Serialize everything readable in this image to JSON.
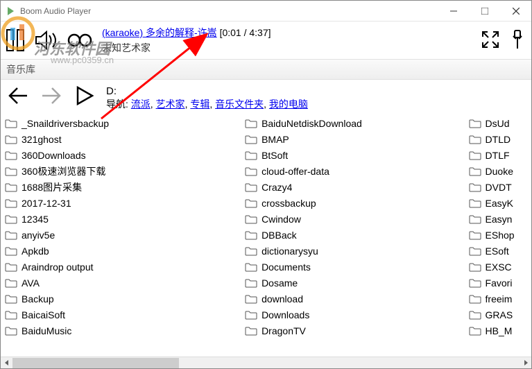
{
  "window": {
    "title": "Boom Audio Player"
  },
  "player": {
    "track_link": "(karaoke) 多余的解释-许嵩",
    "time_display": "[0:01 / 4:37]",
    "artist": "未知艺术家"
  },
  "library": {
    "label": "音乐库"
  },
  "nav": {
    "path": "D:",
    "prefix": "导航: ",
    "crumbs": [
      "流派",
      "艺术家",
      "专辑",
      "音乐文件夹",
      "我的电脑"
    ]
  },
  "folders": {
    "col1": [
      "_Snaildriversbackup",
      "321ghost",
      "360Downloads",
      "360极速浏览器下载",
      "1688图片采集",
      "2017-12-31",
      "12345",
      "anyiv5e",
      "Apkdb",
      "Araindrop output",
      "AVA",
      "Backup",
      "BaicaiSoft",
      "BaiduMusic"
    ],
    "col2": [
      "BaiduNetdiskDownload",
      "BMAP",
      "BtSoft",
      "cloud-offer-data",
      "Crazy4",
      "crossbackup",
      "Cwindow",
      "DBBack",
      "dictionarysyu",
      "Documents",
      "Dosame",
      "download",
      "Downloads",
      "DragonTV"
    ],
    "col3": [
      "DsUd",
      "DTLD",
      "DTLF",
      "Duoke",
      "DVDT",
      "EasyK",
      "Easyn",
      "EShop",
      "ESoft",
      "EXSC",
      "Favori",
      "freeim",
      "GRAS",
      "HB_M"
    ]
  },
  "watermark": {
    "text": "河东软件园",
    "url": "www.pc0359.cn"
  }
}
